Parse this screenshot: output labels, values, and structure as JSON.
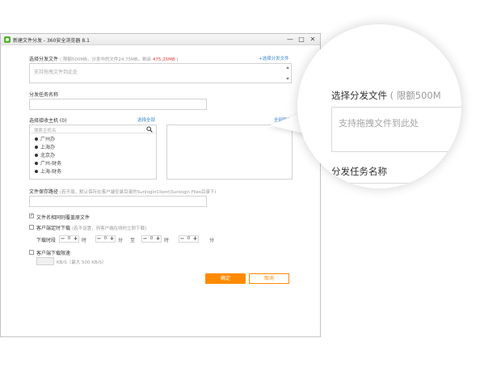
{
  "window": {
    "title": "新建文件分发 - 360安全浏览器 8.1",
    "controls": {
      "minimize": "—",
      "maximize": "□",
      "close": "✕"
    }
  },
  "file_select": {
    "label": "选择分发文件",
    "hint_prefix": "( 限额500MB，分发中的文件24.75MB，剩余 ",
    "remaining": "475.25MB",
    "hint_suffix": " )",
    "add_link": "+选择分发文件",
    "drop_placeholder": "支持拖拽文件到此处"
  },
  "task_name": {
    "label": "分发任务名称",
    "value": ""
  },
  "hosts": {
    "label": "选择接收主机 (0)",
    "select_all": "选择全部",
    "clear_all": "全部取消",
    "search_placeholder": "搜索主机名",
    "items": [
      "广州办",
      "上海办",
      "北京办",
      "广州-财务",
      "上海-财务"
    ]
  },
  "save_path": {
    "label": "文件保存路径",
    "hint": "(若不填，默认保存在客户端安装目录的SunloginClient\\Sunlogin Files目录下)",
    "value": ""
  },
  "overwrite": {
    "label": "文件名相同则覆盖原文件",
    "checked": true
  },
  "schedule": {
    "label": "客户端定时下载",
    "hint": "(若不设置，则客户端在线时立即下载)",
    "checked": false,
    "period_label": "下载时段",
    "from_hour": "0",
    "from_minute": "0",
    "to_hour": "0",
    "to_minute": "0",
    "hour_unit": "时",
    "minute_unit": "分",
    "to_label": "至"
  },
  "speed_limit": {
    "label": "客户端下载限速",
    "checked": false,
    "unit_hint": "KB/S（最大 500 KB/S）",
    "value": ""
  },
  "buttons": {
    "ok": "确定",
    "cancel": "取消"
  },
  "magnifier": {
    "file_label": "选择分发文件",
    "file_hint": "( 限额500M",
    "drop_placeholder": "支持拖拽文件到此处",
    "task_label": "分发任务名称"
  },
  "colors": {
    "accent": "#ff8a00",
    "link": "#3c87d6",
    "remaining": "#e63c3c"
  },
  "icons": {
    "app": "browser-logo-icon",
    "search": "search-icon",
    "check": "checkmark-icon"
  }
}
